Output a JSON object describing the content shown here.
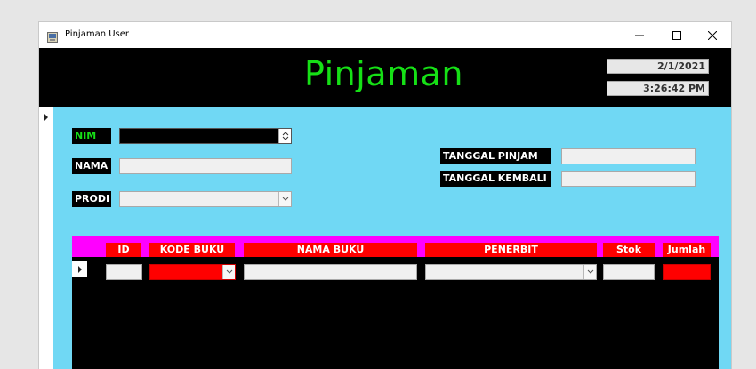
{
  "window": {
    "title": "Pinjaman User",
    "icon": "app-window-icon"
  },
  "header": {
    "title": "Pinjaman",
    "date": "2/1/2021",
    "time": "3:26:42 PM",
    "title_color": "#16e016"
  },
  "form": {
    "nim_label": "NIM",
    "nim_value": "",
    "nama_label": "NAMA",
    "nama_value": "",
    "prodi_label": "PRODI",
    "prodi_value": "",
    "tanggal_pinjam_label": "TANGGAL PINJAM",
    "tanggal_pinjam_value": "",
    "tanggal_kembali_label": "TANGGAL KEMBALI",
    "tanggal_kembali_value": ""
  },
  "grid": {
    "columns": [
      "ID",
      "KODE BUKU",
      "NAMA BUKU",
      "PENERBIT",
      "Stok",
      "Jumlah"
    ],
    "row": {
      "id": "",
      "kode_buku": "",
      "nama_buku": "",
      "penerbit": "",
      "stok": "",
      "jumlah": ""
    }
  },
  "colors": {
    "background": "#70d8f4",
    "header_bg": "#000000",
    "grid_header": "#ff00ff",
    "column_header": "#ff0000"
  }
}
